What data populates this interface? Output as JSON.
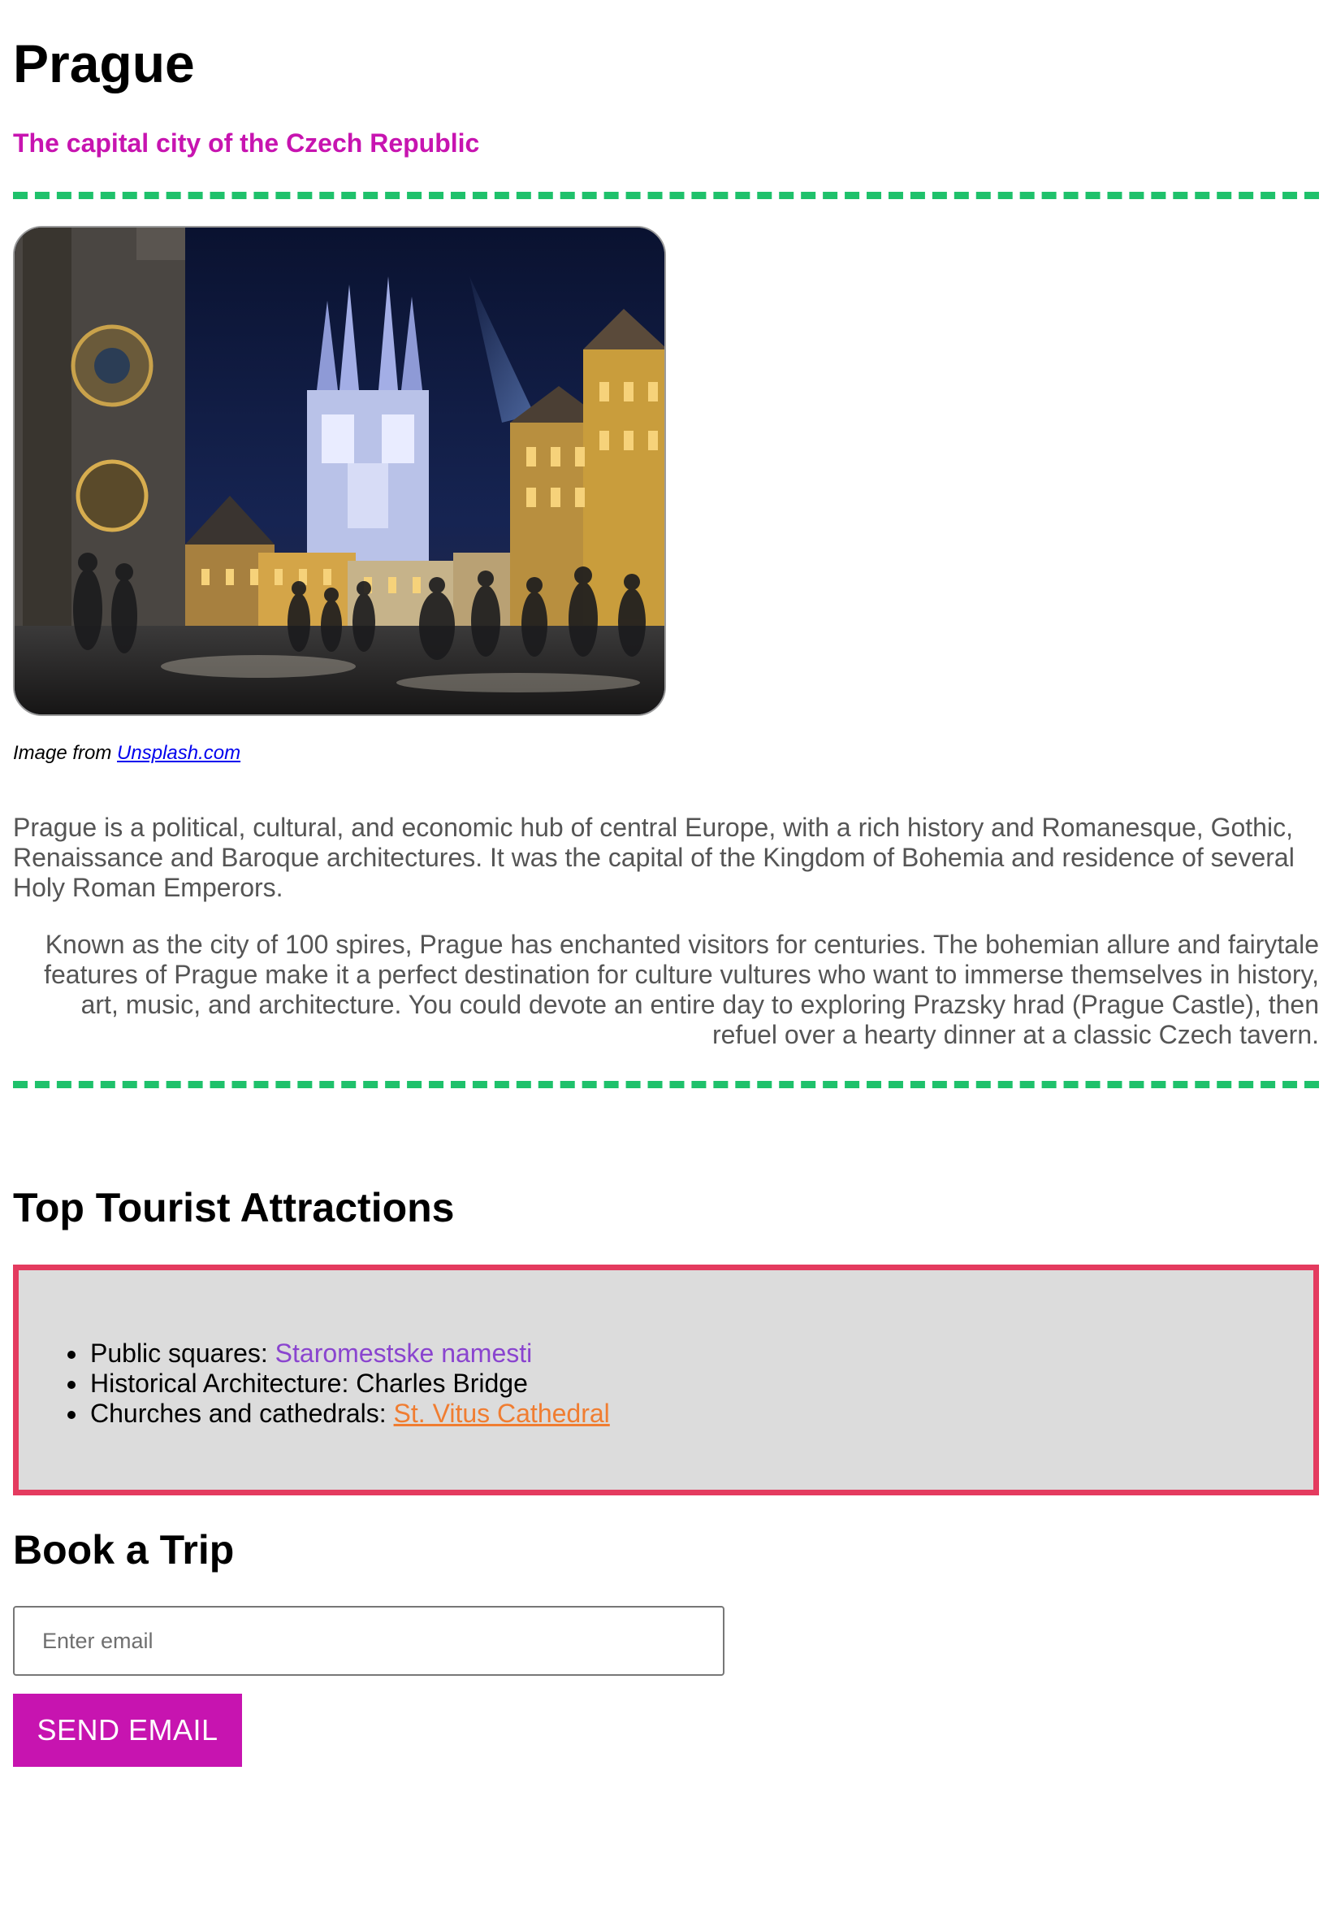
{
  "header": {
    "title": "Prague",
    "subtitle": "The capital city of the Czech Republic"
  },
  "photo": {
    "alt": "Old Town Square in Prague at night with the Church of Our Lady before Týn"
  },
  "caption": {
    "prefix": "Image from ",
    "link_text": "Unsplash.com"
  },
  "intro": {
    "paragraph1": "Prague is a political, cultural, and economic hub of central Europe, with a rich history and Romanesque, Gothic, Renaissance and Baroque architectures. It was the capital of the Kingdom of Bohemia and residence of several Holy Roman Emperors.",
    "paragraph2": "Known as the city of 100 spires, Prague has enchanted visitors for centuries. The bohemian allure and fairytale features of Prague make it a perfect destination for culture vultures who want to immerse themselves in history, art, music, and architecture. You could devote an entire day to exploring Prazsky hrad (Prague Castle), then refuel over a hearty dinner at a classic Czech tavern."
  },
  "attractions": {
    "heading": "Top Tourist Attractions",
    "items": [
      {
        "label": "Public squares: ",
        "value": "Staromestske namesti"
      },
      {
        "label": "Historical Architecture: ",
        "value": "Charles Bridge"
      },
      {
        "label": "Churches and cathedrals: ",
        "value": "St. Vitus Cathedral"
      }
    ]
  },
  "booking": {
    "heading": "Book a Trip",
    "email_placeholder": "Enter email",
    "email_value": "",
    "button_label": "SEND EMAIL"
  },
  "colors": {
    "accent": "#c714b0",
    "divider": "#1fc16b",
    "attractions_border": "#e43b5f",
    "attractions_bg": "#dcdcdc",
    "link_purple": "#8a44cf",
    "link_orange": "#f07d31"
  }
}
